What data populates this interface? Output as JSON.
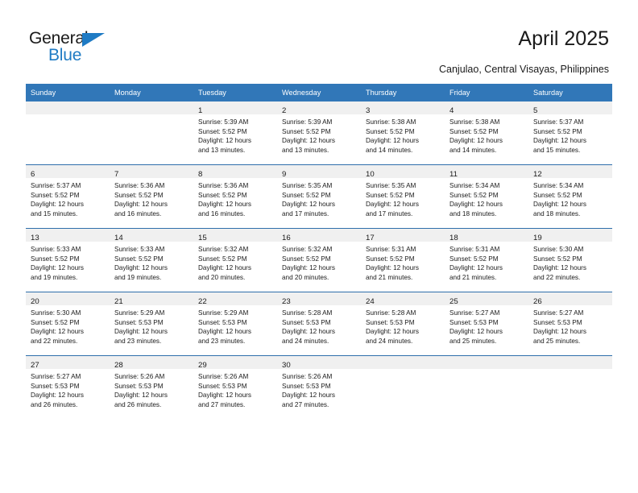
{
  "logo": {
    "word_top": "General",
    "word_bottom": "Blue",
    "triangle_color": "#1f7bc4",
    "text_color": "#1a1a1a",
    "blue_color": "#1f7bc4"
  },
  "header": {
    "title": "April 2025",
    "subtitle": "Canjulao, Central Visayas, Philippines"
  },
  "theme": {
    "header_blue": "#3177b8",
    "row_divider_blue": "#2f6fab",
    "daynum_band": "#f0f0f0"
  },
  "weekday_headers": [
    "Sunday",
    "Monday",
    "Tuesday",
    "Wednesday",
    "Thursday",
    "Friday",
    "Saturday"
  ],
  "weeks": [
    [
      {
        "day": "",
        "sunrise": "",
        "sunset": "",
        "daylight1": "",
        "daylight2": ""
      },
      {
        "day": "",
        "sunrise": "",
        "sunset": "",
        "daylight1": "",
        "daylight2": ""
      },
      {
        "day": "1",
        "sunrise": "Sunrise: 5:39 AM",
        "sunset": "Sunset: 5:52 PM",
        "daylight1": "Daylight: 12 hours",
        "daylight2": "and 13 minutes."
      },
      {
        "day": "2",
        "sunrise": "Sunrise: 5:39 AM",
        "sunset": "Sunset: 5:52 PM",
        "daylight1": "Daylight: 12 hours",
        "daylight2": "and 13 minutes."
      },
      {
        "day": "3",
        "sunrise": "Sunrise: 5:38 AM",
        "sunset": "Sunset: 5:52 PM",
        "daylight1": "Daylight: 12 hours",
        "daylight2": "and 14 minutes."
      },
      {
        "day": "4",
        "sunrise": "Sunrise: 5:38 AM",
        "sunset": "Sunset: 5:52 PM",
        "daylight1": "Daylight: 12 hours",
        "daylight2": "and 14 minutes."
      },
      {
        "day": "5",
        "sunrise": "Sunrise: 5:37 AM",
        "sunset": "Sunset: 5:52 PM",
        "daylight1": "Daylight: 12 hours",
        "daylight2": "and 15 minutes."
      }
    ],
    [
      {
        "day": "6",
        "sunrise": "Sunrise: 5:37 AM",
        "sunset": "Sunset: 5:52 PM",
        "daylight1": "Daylight: 12 hours",
        "daylight2": "and 15 minutes."
      },
      {
        "day": "7",
        "sunrise": "Sunrise: 5:36 AM",
        "sunset": "Sunset: 5:52 PM",
        "daylight1": "Daylight: 12 hours",
        "daylight2": "and 16 minutes."
      },
      {
        "day": "8",
        "sunrise": "Sunrise: 5:36 AM",
        "sunset": "Sunset: 5:52 PM",
        "daylight1": "Daylight: 12 hours",
        "daylight2": "and 16 minutes."
      },
      {
        "day": "9",
        "sunrise": "Sunrise: 5:35 AM",
        "sunset": "Sunset: 5:52 PM",
        "daylight1": "Daylight: 12 hours",
        "daylight2": "and 17 minutes."
      },
      {
        "day": "10",
        "sunrise": "Sunrise: 5:35 AM",
        "sunset": "Sunset: 5:52 PM",
        "daylight1": "Daylight: 12 hours",
        "daylight2": "and 17 minutes."
      },
      {
        "day": "11",
        "sunrise": "Sunrise: 5:34 AM",
        "sunset": "Sunset: 5:52 PM",
        "daylight1": "Daylight: 12 hours",
        "daylight2": "and 18 minutes."
      },
      {
        "day": "12",
        "sunrise": "Sunrise: 5:34 AM",
        "sunset": "Sunset: 5:52 PM",
        "daylight1": "Daylight: 12 hours",
        "daylight2": "and 18 minutes."
      }
    ],
    [
      {
        "day": "13",
        "sunrise": "Sunrise: 5:33 AM",
        "sunset": "Sunset: 5:52 PM",
        "daylight1": "Daylight: 12 hours",
        "daylight2": "and 19 minutes."
      },
      {
        "day": "14",
        "sunrise": "Sunrise: 5:33 AM",
        "sunset": "Sunset: 5:52 PM",
        "daylight1": "Daylight: 12 hours",
        "daylight2": "and 19 minutes."
      },
      {
        "day": "15",
        "sunrise": "Sunrise: 5:32 AM",
        "sunset": "Sunset: 5:52 PM",
        "daylight1": "Daylight: 12 hours",
        "daylight2": "and 20 minutes."
      },
      {
        "day": "16",
        "sunrise": "Sunrise: 5:32 AM",
        "sunset": "Sunset: 5:52 PM",
        "daylight1": "Daylight: 12 hours",
        "daylight2": "and 20 minutes."
      },
      {
        "day": "17",
        "sunrise": "Sunrise: 5:31 AM",
        "sunset": "Sunset: 5:52 PM",
        "daylight1": "Daylight: 12 hours",
        "daylight2": "and 21 minutes."
      },
      {
        "day": "18",
        "sunrise": "Sunrise: 5:31 AM",
        "sunset": "Sunset: 5:52 PM",
        "daylight1": "Daylight: 12 hours",
        "daylight2": "and 21 minutes."
      },
      {
        "day": "19",
        "sunrise": "Sunrise: 5:30 AM",
        "sunset": "Sunset: 5:52 PM",
        "daylight1": "Daylight: 12 hours",
        "daylight2": "and 22 minutes."
      }
    ],
    [
      {
        "day": "20",
        "sunrise": "Sunrise: 5:30 AM",
        "sunset": "Sunset: 5:52 PM",
        "daylight1": "Daylight: 12 hours",
        "daylight2": "and 22 minutes."
      },
      {
        "day": "21",
        "sunrise": "Sunrise: 5:29 AM",
        "sunset": "Sunset: 5:53 PM",
        "daylight1": "Daylight: 12 hours",
        "daylight2": "and 23 minutes."
      },
      {
        "day": "22",
        "sunrise": "Sunrise: 5:29 AM",
        "sunset": "Sunset: 5:53 PM",
        "daylight1": "Daylight: 12 hours",
        "daylight2": "and 23 minutes."
      },
      {
        "day": "23",
        "sunrise": "Sunrise: 5:28 AM",
        "sunset": "Sunset: 5:53 PM",
        "daylight1": "Daylight: 12 hours",
        "daylight2": "and 24 minutes."
      },
      {
        "day": "24",
        "sunrise": "Sunrise: 5:28 AM",
        "sunset": "Sunset: 5:53 PM",
        "daylight1": "Daylight: 12 hours",
        "daylight2": "and 24 minutes."
      },
      {
        "day": "25",
        "sunrise": "Sunrise: 5:27 AM",
        "sunset": "Sunset: 5:53 PM",
        "daylight1": "Daylight: 12 hours",
        "daylight2": "and 25 minutes."
      },
      {
        "day": "26",
        "sunrise": "Sunrise: 5:27 AM",
        "sunset": "Sunset: 5:53 PM",
        "daylight1": "Daylight: 12 hours",
        "daylight2": "and 25 minutes."
      }
    ],
    [
      {
        "day": "27",
        "sunrise": "Sunrise: 5:27 AM",
        "sunset": "Sunset: 5:53 PM",
        "daylight1": "Daylight: 12 hours",
        "daylight2": "and 26 minutes."
      },
      {
        "day": "28",
        "sunrise": "Sunrise: 5:26 AM",
        "sunset": "Sunset: 5:53 PM",
        "daylight1": "Daylight: 12 hours",
        "daylight2": "and 26 minutes."
      },
      {
        "day": "29",
        "sunrise": "Sunrise: 5:26 AM",
        "sunset": "Sunset: 5:53 PM",
        "daylight1": "Daylight: 12 hours",
        "daylight2": "and 27 minutes."
      },
      {
        "day": "30",
        "sunrise": "Sunrise: 5:26 AM",
        "sunset": "Sunset: 5:53 PM",
        "daylight1": "Daylight: 12 hours",
        "daylight2": "and 27 minutes."
      },
      {
        "day": "",
        "sunrise": "",
        "sunset": "",
        "daylight1": "",
        "daylight2": ""
      },
      {
        "day": "",
        "sunrise": "",
        "sunset": "",
        "daylight1": "",
        "daylight2": ""
      },
      {
        "day": "",
        "sunrise": "",
        "sunset": "",
        "daylight1": "",
        "daylight2": ""
      }
    ]
  ]
}
